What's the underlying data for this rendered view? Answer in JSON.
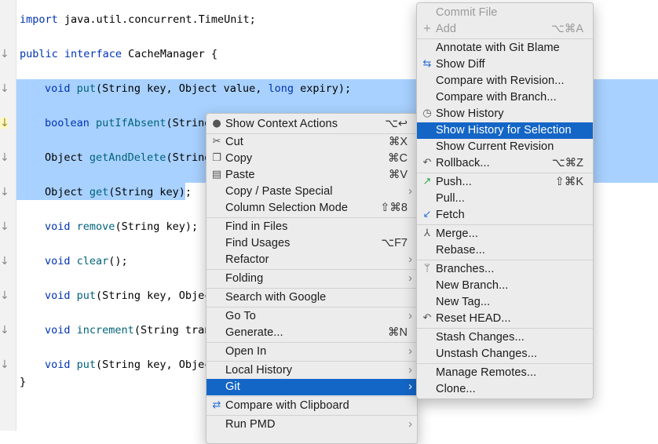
{
  "code": {
    "lines": [
      {
        "top": "import java.util.concurrent.TimeUnit;"
      },
      "public interface CacheManager {",
      "void put(String key, Object value, long expiry);",
      "boolean putIfAbsent(String",
      "Object getAndDelete(String",
      "Object get(String key);",
      "void remove(String key);",
      "void clear();",
      "void put(String key, Object",
      "void increment(String trans",
      "void put(String key, Object",
      "}"
    ]
  },
  "context_menu": {
    "items": [
      {
        "label": "Show Context Actions",
        "shortcut": "⌥↩",
        "icon": "bulb-icon"
      },
      {
        "label": "Cut",
        "shortcut": "⌘X",
        "icon": "scissors-icon"
      },
      {
        "label": "Copy",
        "shortcut": "⌘C",
        "icon": "copy-icon"
      },
      {
        "label": "Paste",
        "shortcut": "⌘V",
        "icon": "paste-icon"
      },
      {
        "label": "Copy / Paste Special",
        "submenu": true
      },
      {
        "label": "Column Selection Mode",
        "shortcut": "⇧⌘8"
      },
      {
        "label": "Find in Files"
      },
      {
        "label": "Find Usages",
        "shortcut": "⌥F7"
      },
      {
        "label": "Refactor",
        "submenu": true
      },
      {
        "label": "Folding",
        "submenu": true
      },
      {
        "label": "Search with Google"
      },
      {
        "label": "Go To",
        "submenu": true
      },
      {
        "label": "Generate...",
        "shortcut": "⌘N"
      },
      {
        "label": "Open In",
        "submenu": true
      },
      {
        "label": "Local History",
        "submenu": true
      },
      {
        "label": "Git",
        "submenu": true,
        "active": true
      },
      {
        "label": "Compare with Clipboard",
        "icon": "compare-clipboard-icon"
      },
      {
        "label": "Run PMD",
        "submenu": true
      }
    ]
  },
  "git_menu": {
    "items": [
      {
        "label": "Commit File",
        "disabled": true
      },
      {
        "label": "Add",
        "shortcut": "⌥⌘A",
        "disabled": true,
        "icon": "plus-icon"
      },
      {
        "label": "Annotate with Git Blame"
      },
      {
        "label": "Show Diff",
        "icon": "diff-icon"
      },
      {
        "label": "Compare with Revision..."
      },
      {
        "label": "Compare with Branch..."
      },
      {
        "label": "Show History",
        "icon": "clock-icon"
      },
      {
        "label": "Show History for Selection",
        "active": true
      },
      {
        "label": "Show Current Revision"
      },
      {
        "label": "Rollback...",
        "shortcut": "⌥⌘Z",
        "icon": "rollback-icon"
      },
      {
        "label": "Push...",
        "shortcut": "⇧⌘K",
        "icon": "push-icon"
      },
      {
        "label": "Pull..."
      },
      {
        "label": "Fetch",
        "icon": "fetch-icon"
      },
      {
        "label": "Merge...",
        "icon": "merge-icon"
      },
      {
        "label": "Rebase..."
      },
      {
        "label": "Branches...",
        "icon": "branch-icon"
      },
      {
        "label": "New Branch..."
      },
      {
        "label": "New Tag..."
      },
      {
        "label": "Reset HEAD...",
        "icon": "reset-icon"
      },
      {
        "label": "Stash Changes..."
      },
      {
        "label": "Unstash Changes..."
      },
      {
        "label": "Manage Remotes..."
      },
      {
        "label": "Clone..."
      }
    ]
  },
  "colors": {
    "selection": "#a8d1ff",
    "menu_active": "#1466c6",
    "keyword": "#0033b3",
    "method": "#00627a"
  }
}
